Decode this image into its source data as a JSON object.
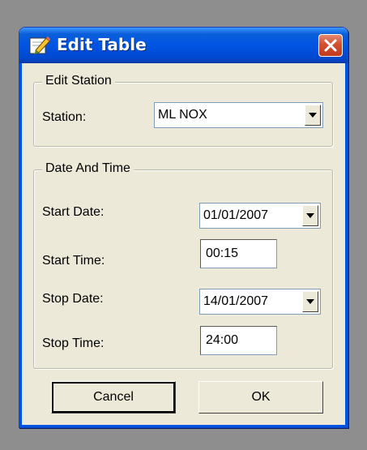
{
  "window": {
    "title": "Edit Table",
    "icon": "edit-pencil-icon",
    "close_icon": "close-icon"
  },
  "station_group": {
    "legend": "Edit Station",
    "station_label": "Station:",
    "station_value": "ML NOX"
  },
  "datetime_group": {
    "legend": "Date And Time",
    "start_date_label": "Start Date:",
    "start_date_value": "01/01/2007",
    "start_time_label": "Start Time:",
    "start_time_value": "00:15",
    "stop_date_label": "Stop Date:",
    "stop_date_value": "14/01/2007",
    "stop_time_label": "Stop Time:",
    "stop_time_value": "24:00"
  },
  "buttons": {
    "cancel": "Cancel",
    "ok": "OK"
  },
  "colors": {
    "titlebar": "#0054e3",
    "dialog_bg": "#ece9d8",
    "close_button": "#d2502f",
    "desktop": "#8e8e8e"
  }
}
